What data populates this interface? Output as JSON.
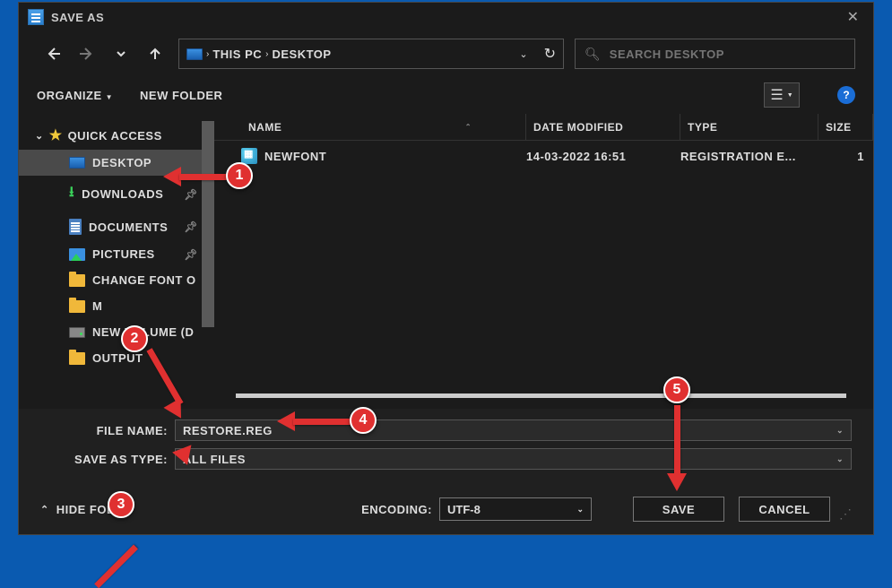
{
  "titlebar": {
    "title": "SAVE AS"
  },
  "nav": {
    "crumbs": {
      "root": "THIS PC",
      "leaf": "DESKTOP"
    },
    "search_placeholder": "SEARCH DESKTOP"
  },
  "toolbar": {
    "organize": "ORGANIZE",
    "new_folder": "NEW FOLDER",
    "help": "?"
  },
  "sidebar": {
    "header": "QUICK ACCESS",
    "items": [
      {
        "label": "DESKTOP",
        "icon": "monitor",
        "pinned": false,
        "selected": true
      },
      {
        "label": "DOWNLOADS",
        "icon": "download",
        "pinned": true,
        "selected": false
      },
      {
        "label": "DOCUMENTS",
        "icon": "doc",
        "pinned": true,
        "selected": false
      },
      {
        "label": "PICTURES",
        "icon": "pic",
        "pinned": true,
        "selected": false
      },
      {
        "label": "CHANGE FONT O",
        "icon": "folder",
        "pinned": false,
        "selected": false
      },
      {
        "label": "M",
        "icon": "folder",
        "pinned": false,
        "selected": false
      },
      {
        "label": "NEW VOLUME (D",
        "icon": "hdd",
        "pinned": false,
        "selected": false
      },
      {
        "label": "OUTPUT",
        "icon": "folder",
        "pinned": false,
        "selected": false
      }
    ]
  },
  "columns": {
    "name": "NAME",
    "date": "DATE MODIFIED",
    "type": "TYPE",
    "size": "SIZE"
  },
  "files": [
    {
      "name": "NEWFONT",
      "date": "14-03-2022 16:51",
      "type": "REGISTRATION E...",
      "size": "1"
    }
  ],
  "form": {
    "file_name_label": "FILE NAME:",
    "file_name_value": "RESTORE.REG",
    "save_type_label": "SAVE AS TYPE:",
    "save_type_value": "ALL FILES",
    "hide_folders": "HIDE FOL",
    "encoding_label": "ENCODING:",
    "encoding_value": "UTF-8",
    "save": "SAVE",
    "cancel": "CANCEL"
  },
  "annotations": {
    "b1": "1",
    "b2": "2",
    "b3": "3",
    "b4": "4",
    "b5": "5"
  }
}
